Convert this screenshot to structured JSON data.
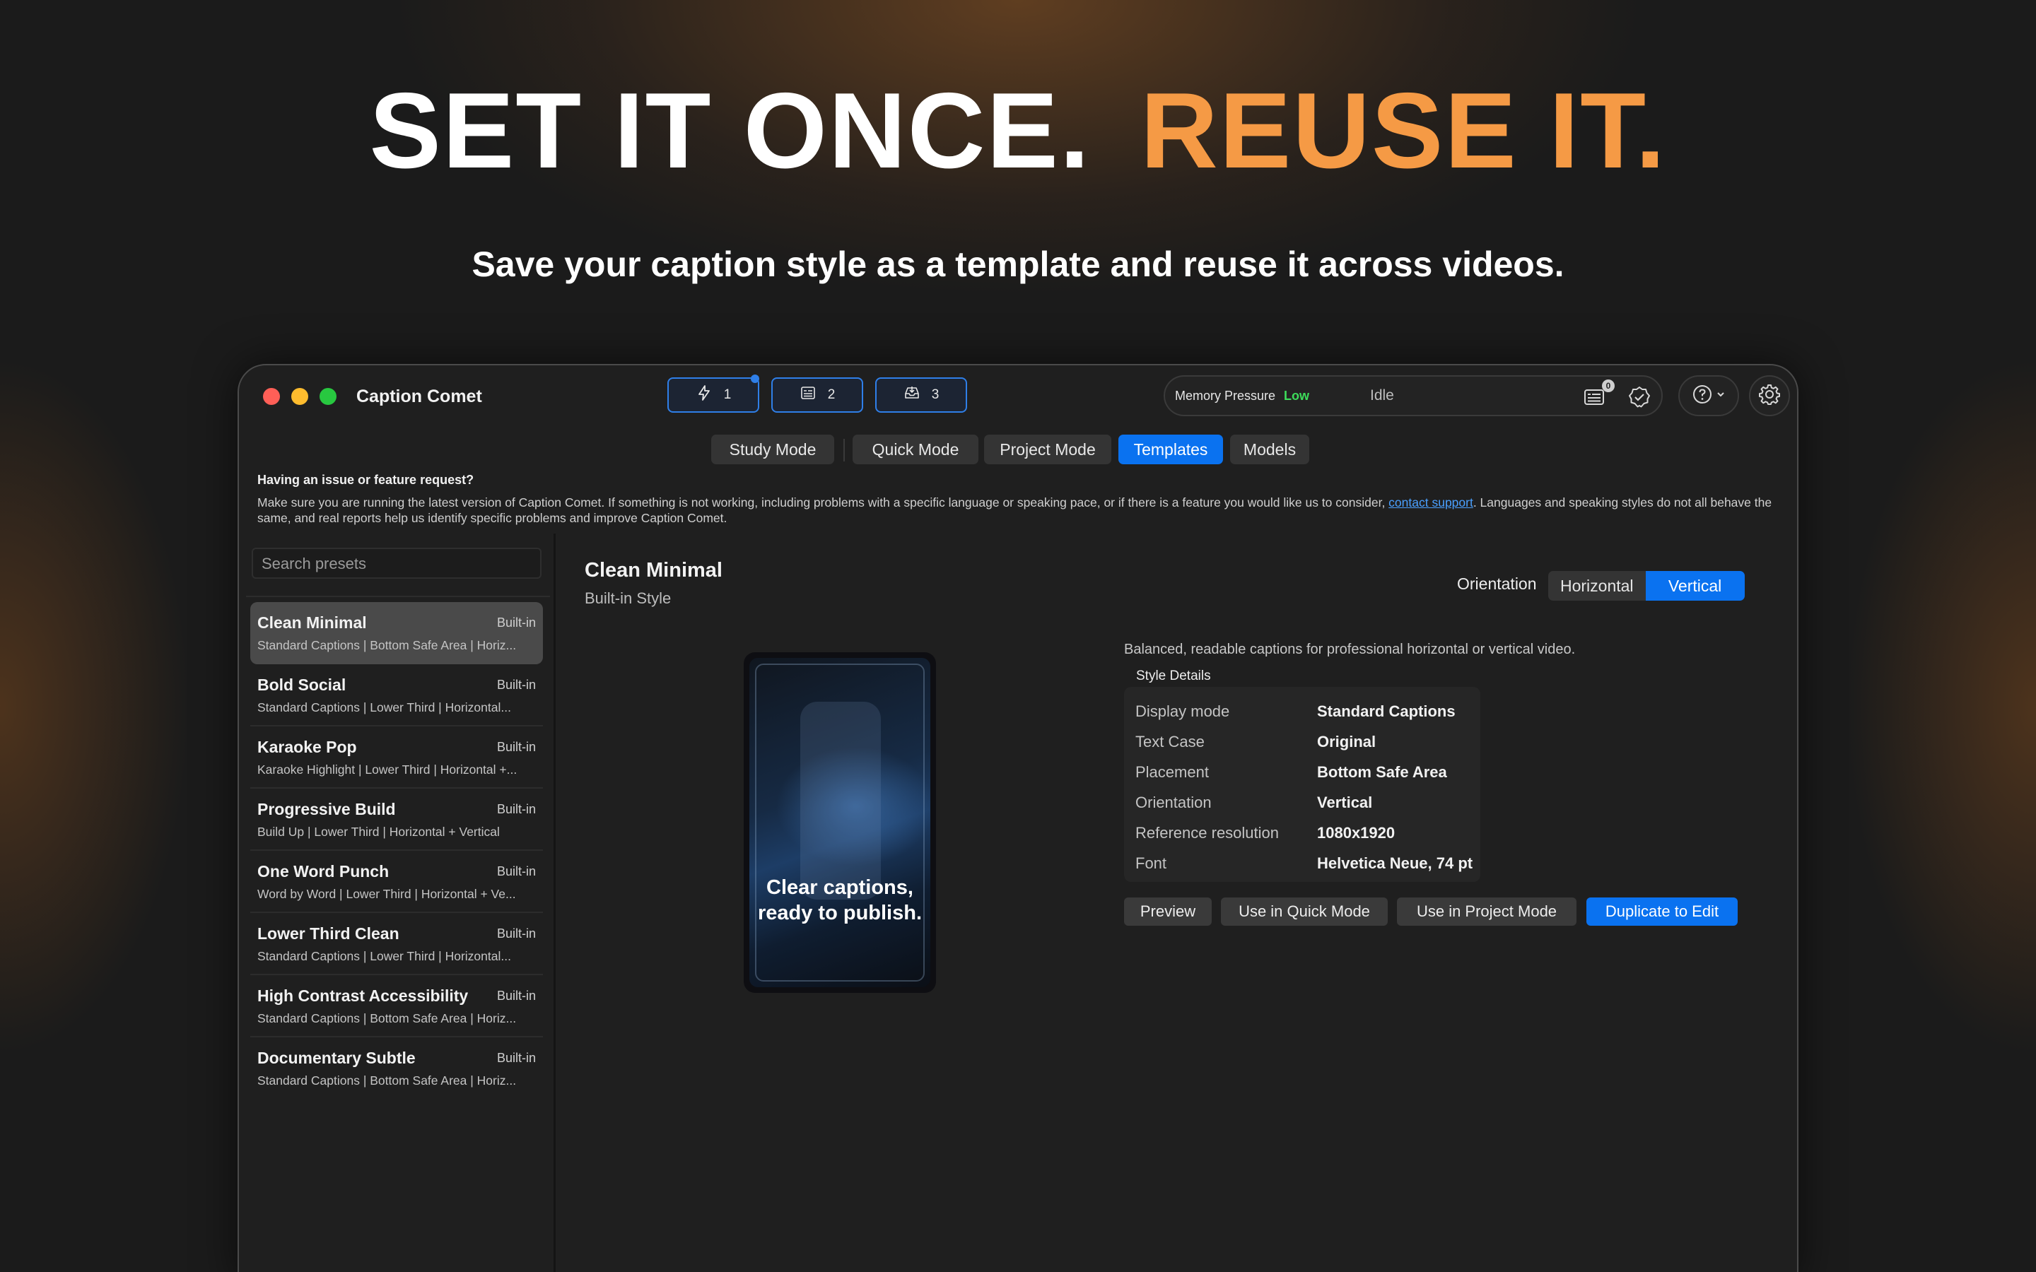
{
  "hero": {
    "title_white": "SET IT ONCE.",
    "title_orange": "REUSE IT.",
    "subtitle": "Save your caption style as a template and reuse it across videos."
  },
  "window": {
    "app_title": "Caption Comet",
    "queue_buttons": [
      {
        "icon": "bolt-icon",
        "count": "1"
      },
      {
        "icon": "list-icon",
        "count": "2"
      },
      {
        "icon": "tray-icon",
        "count": "3"
      }
    ],
    "status": {
      "memory_label": "Memory Pressure",
      "memory_value": "Low",
      "state": "Idle",
      "badge_count": "0"
    }
  },
  "tabs": [
    "Study Mode",
    "Quick Mode",
    "Project Mode",
    "Templates",
    "Models"
  ],
  "active_tab": "Templates",
  "notice": {
    "title": "Having an issue or feature request?",
    "body_before": "Make sure you are running the latest version of Caption Comet. If something is not working, including problems with a specific language or speaking pace, or if there is a feature you would like us to consider, ",
    "link": "contact support",
    "body_after": ". Languages and speaking styles do not all behave the same, and real reports help us identify specific problems and improve Caption Comet."
  },
  "sidebar": {
    "search_placeholder": "Search presets",
    "presets": [
      {
        "name": "Clean Minimal",
        "tag": "Built-in",
        "meta": "Standard Captions | Bottom Safe Area | Horiz..."
      },
      {
        "name": "Bold Social",
        "tag": "Built-in",
        "meta": "Standard Captions | Lower Third | Horizontal..."
      },
      {
        "name": "Karaoke Pop",
        "tag": "Built-in",
        "meta": "Karaoke Highlight | Lower Third | Horizontal +..."
      },
      {
        "name": "Progressive Build",
        "tag": "Built-in",
        "meta": "Build Up | Lower Third | Horizontal + Vertical"
      },
      {
        "name": "One Word Punch",
        "tag": "Built-in",
        "meta": "Word by Word | Lower Third | Horizontal + Ve..."
      },
      {
        "name": "Lower Third Clean",
        "tag": "Built-in",
        "meta": "Standard Captions | Lower Third | Horizontal..."
      },
      {
        "name": "High Contrast Accessibility",
        "tag": "Built-in",
        "meta": "Standard Captions | Bottom Safe Area | Horiz..."
      },
      {
        "name": "Documentary Subtle",
        "tag": "Built-in",
        "meta": "Standard Captions | Bottom Safe Area | Horiz..."
      }
    ]
  },
  "detail": {
    "title": "Clean Minimal",
    "subtitle": "Built-in Style",
    "orientation_label": "Orientation",
    "orientation_options": [
      "Horizontal",
      "Vertical"
    ],
    "orientation_selected": "Vertical",
    "preview_caption": "Clear captions, ready to publish.",
    "description": "Balanced, readable captions for professional horizontal or vertical video.",
    "details_title": "Style Details",
    "details": [
      {
        "key": "Display mode",
        "value": "Standard Captions"
      },
      {
        "key": "Text Case",
        "value": "Original"
      },
      {
        "key": "Placement",
        "value": "Bottom Safe Area"
      },
      {
        "key": "Orientation",
        "value": "Vertical"
      },
      {
        "key": "Reference resolution",
        "value": "1080x1920"
      },
      {
        "key": "Font",
        "value": "Helvetica Neue, 74 pt"
      }
    ],
    "actions": [
      "Preview",
      "Use in Quick Mode",
      "Use in Project Mode",
      "Duplicate to Edit"
    ]
  },
  "colors": {
    "accent_blue": "#0a72f0",
    "hero_orange": "#f59a45",
    "memory_low_green": "#3ddc5a"
  }
}
